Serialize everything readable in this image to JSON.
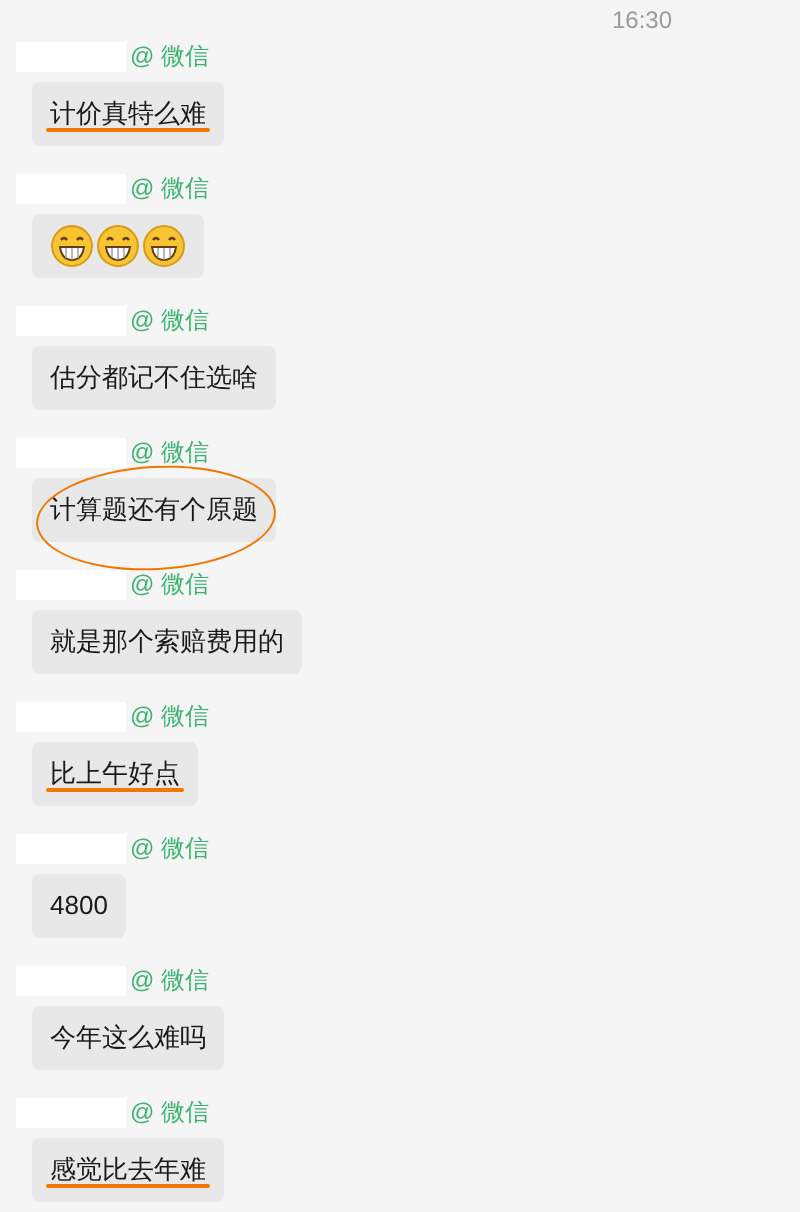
{
  "timestamp": "16:30",
  "messages": [
    {
      "sender_tag": "@ 微信",
      "kind": "text",
      "text": "计价真特么难",
      "underlined": true
    },
    {
      "sender_tag": "@ 微信",
      "kind": "emoji",
      "emoji": [
        {
          "kind": "grin"
        },
        {
          "kind": "grin"
        },
        {
          "kind": "grin"
        }
      ]
    },
    {
      "sender_tag": "@ 微信",
      "kind": "text",
      "text": "估分都记不住选啥"
    },
    {
      "sender_tag": "@ 微信",
      "kind": "text",
      "text": "计算题还有个原题",
      "circled": true
    },
    {
      "sender_tag": "@ 微信",
      "kind": "text",
      "text": "就是那个索赔费用的"
    },
    {
      "sender_tag": "@ 微信",
      "kind": "text",
      "text": "比上午好点",
      "underlined": true
    },
    {
      "sender_tag": "@ 微信",
      "kind": "text",
      "text": "4800"
    },
    {
      "sender_tag": "@ 微信",
      "kind": "text",
      "text": "今年这么难吗"
    },
    {
      "sender_tag": "@ 微信",
      "kind": "text",
      "text": "感觉比去年难",
      "underlined": true
    }
  ]
}
